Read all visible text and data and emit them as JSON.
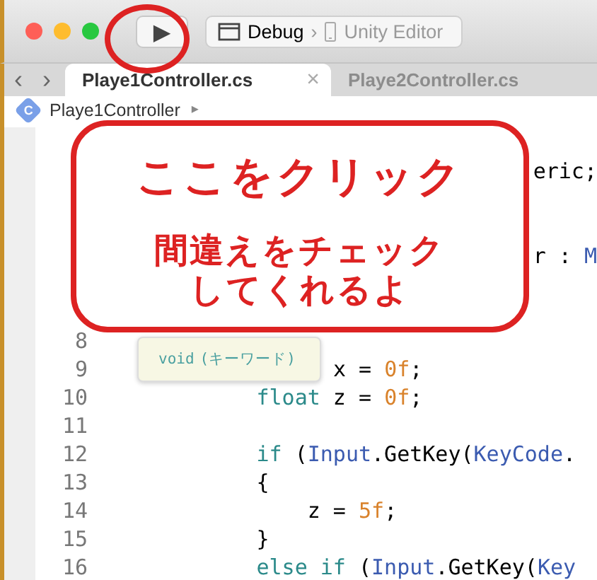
{
  "toolbar": {
    "run_button": "▶",
    "scheme": "Debug",
    "separator": "›",
    "destination": "Unity Editor"
  },
  "navigation": {
    "back": "‹",
    "forward": "›"
  },
  "tabs": [
    {
      "label": "Playe1Controller.cs",
      "selected": true,
      "close": "×"
    },
    {
      "label": "Playe2Controller.cs",
      "selected": false
    }
  ],
  "breadcrumb": {
    "icon": "C",
    "file": "Playe1Controller",
    "separator": "▸"
  },
  "covered_code": [
    {
      "tokens": [
        {
          "kind": "plain",
          "text": "eric;"
        }
      ]
    },
    {
      "tokens": [
        {
          "kind": "plain",
          "text": "r : "
        },
        {
          "kind": "type",
          "text": "M"
        }
      ]
    }
  ],
  "code": [
    {
      "number": "8"
    },
    {
      "number": "9",
      "tokens": [
        {
          "kind": "plain",
          "text": "              x = "
        },
        {
          "kind": "number",
          "text": "0f"
        },
        {
          "kind": "plain",
          "text": ";"
        }
      ]
    },
    {
      "number": "10",
      "tokens": [
        {
          "kind": "keyword",
          "text": "        float"
        },
        {
          "kind": "plain",
          "text": " z = "
        },
        {
          "kind": "number",
          "text": "0f"
        },
        {
          "kind": "plain",
          "text": ";"
        }
      ]
    },
    {
      "number": "11"
    },
    {
      "number": "12",
      "tokens": [
        {
          "kind": "keyword",
          "text": "        if"
        },
        {
          "kind": "plain",
          "text": " ("
        },
        {
          "kind": "type",
          "text": "Input"
        },
        {
          "kind": "plain",
          "text": ".GetKey("
        },
        {
          "kind": "type",
          "text": "KeyCode"
        },
        {
          "kind": "plain",
          "text": "."
        }
      ]
    },
    {
      "number": "13",
      "tokens": [
        {
          "kind": "plain",
          "text": "        {"
        }
      ]
    },
    {
      "number": "14",
      "tokens": [
        {
          "kind": "plain",
          "text": "            z = "
        },
        {
          "kind": "number",
          "text": "5f"
        },
        {
          "kind": "plain",
          "text": ";"
        }
      ]
    },
    {
      "number": "15",
      "tokens": [
        {
          "kind": "plain",
          "text": "        }"
        }
      ]
    },
    {
      "number": "16",
      "tokens": [
        {
          "kind": "keyword",
          "text": "        else if"
        },
        {
          "kind": "plain",
          "text": " ("
        },
        {
          "kind": "type",
          "text": "Input"
        },
        {
          "kind": "plain",
          "text": ".GetKey("
        },
        {
          "kind": "type",
          "text": "Key"
        }
      ]
    }
  ],
  "tooltip": {
    "keyword": "void",
    "description": "(キーワード)"
  },
  "callout": {
    "title": "ここをクリック",
    "lines": [
      "間違えをチェック",
      "してくれるよ"
    ]
  }
}
